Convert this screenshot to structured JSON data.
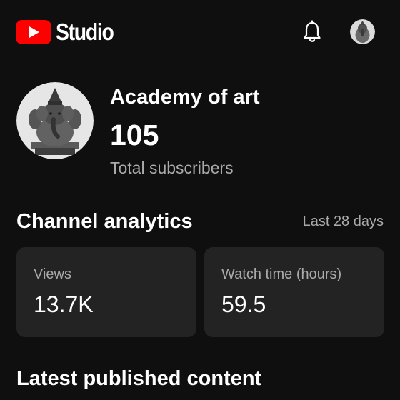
{
  "app": {
    "logo_text": "Studio",
    "icons": {
      "logo": "youtube-play-icon",
      "notifications": "bell-icon",
      "account": "avatar"
    },
    "colors": {
      "brand_red": "#ff0000",
      "background": "#0f0f0f",
      "card": "#232323",
      "secondary_text": "#aaaaaa"
    }
  },
  "channel": {
    "name": "Academy of art",
    "subscribers": "105",
    "subscribers_label": "Total subscribers"
  },
  "analytics": {
    "title": "Channel analytics",
    "period": "Last 28 days",
    "cards": [
      {
        "label": "Views",
        "value": "13.7K"
      },
      {
        "label": "Watch time (hours)",
        "value": "59.5"
      }
    ]
  },
  "latest": {
    "title": "Latest published content"
  }
}
